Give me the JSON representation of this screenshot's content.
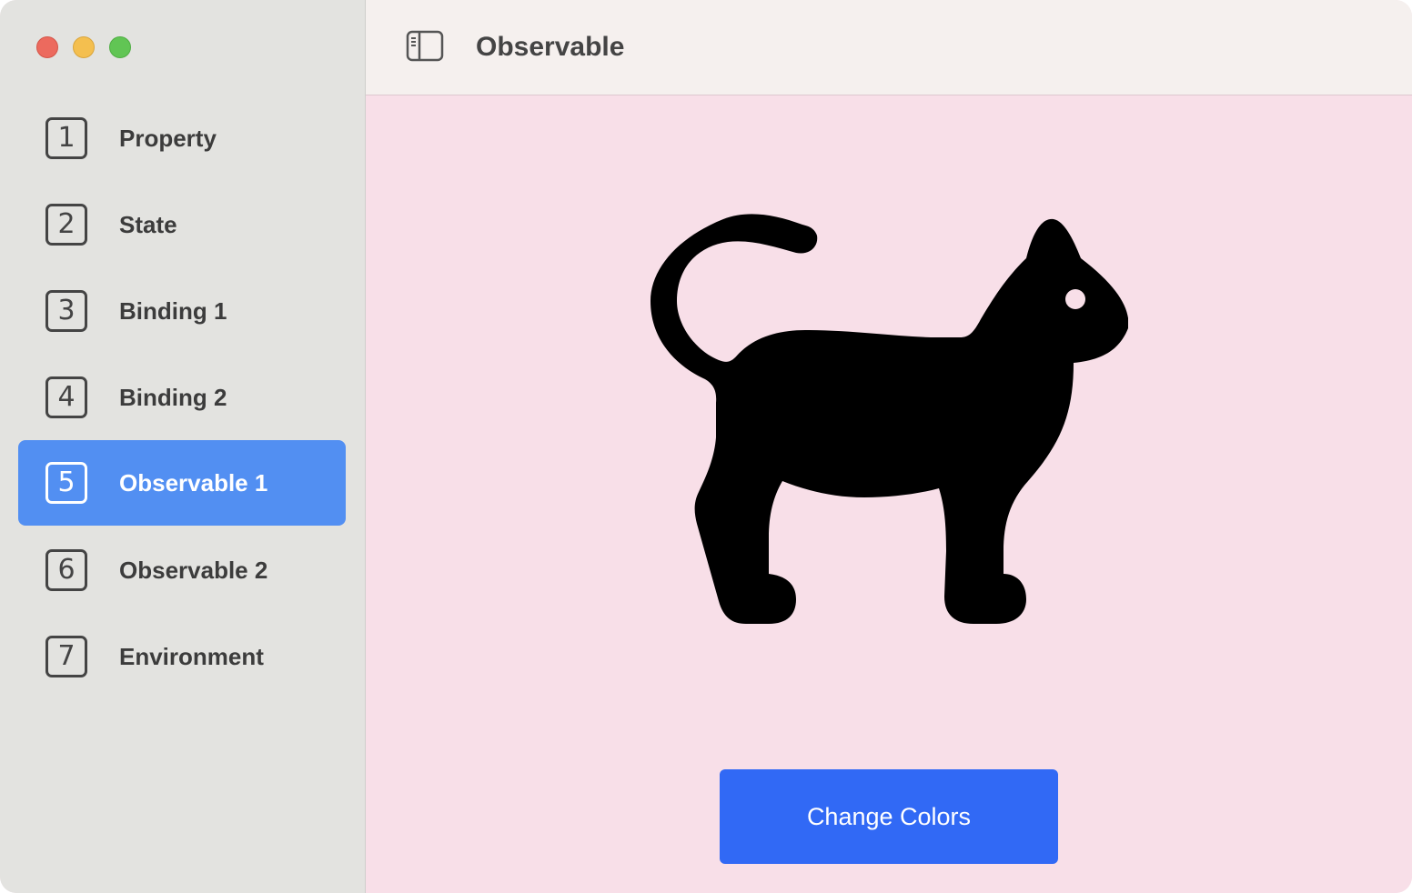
{
  "window": {
    "controls": {
      "close": "close-button",
      "minimize": "minimize-button",
      "zoom": "zoom-button"
    }
  },
  "sidebar": {
    "items": [
      {
        "number": "1",
        "label": "Property",
        "selected": false
      },
      {
        "number": "2",
        "label": "State",
        "selected": false
      },
      {
        "number": "3",
        "label": "Binding 1",
        "selected": false
      },
      {
        "number": "4",
        "label": "Binding 2",
        "selected": false
      },
      {
        "number": "5",
        "label": "Observable 1",
        "selected": true
      },
      {
        "number": "6",
        "label": "Observable 2",
        "selected": false
      },
      {
        "number": "7",
        "label": "Environment",
        "selected": false
      }
    ]
  },
  "header": {
    "title": "Observable",
    "toggle_icon": "sidebar-toggle-icon"
  },
  "main": {
    "image_icon": "cat-icon",
    "button_label": "Change Colors"
  },
  "colors": {
    "sidebar_bg": "#e3e3e0",
    "selected_bg": "#528ff2",
    "content_bg": "#f8dfe8",
    "button_bg": "#3169f5",
    "cat_fill": "#000000"
  }
}
